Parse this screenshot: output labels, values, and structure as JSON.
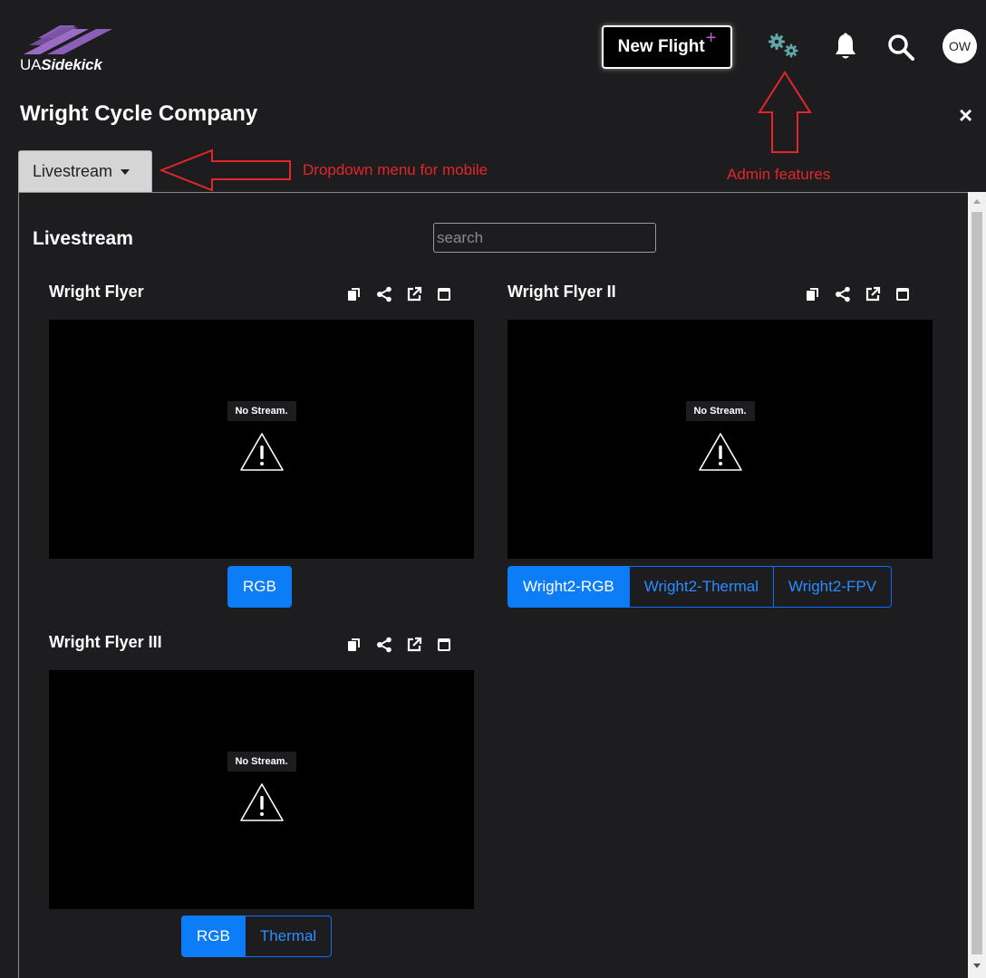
{
  "header": {
    "logo_text_a": "UA",
    "logo_text_b": "Sidekick",
    "new_flight_label": "New Flight",
    "new_flight_plus": "+",
    "avatar_initials": "OW",
    "icons": [
      "gears-icon",
      "bell-icon",
      "search-icon"
    ]
  },
  "company": {
    "name": "Wright Cycle Company",
    "close_label": "×"
  },
  "annotations": {
    "mobile": "Dropdown menu for mobile",
    "admin": "Admin features"
  },
  "tab": {
    "selected": "Livestream"
  },
  "section": {
    "title": "Livestream",
    "search_placeholder": "search"
  },
  "no_stream_text": "No Stream.",
  "cards": [
    {
      "title": "Wright Flyer",
      "buttons": [
        {
          "label": "RGB",
          "active": true
        }
      ]
    },
    {
      "title": "Wright Flyer II",
      "buttons": [
        {
          "label": "Wright2-RGB",
          "active": true
        },
        {
          "label": "Wright2-Thermal",
          "active": false
        },
        {
          "label": "Wright2-FPV",
          "active": false
        }
      ]
    },
    {
      "title": "Wright Flyer III",
      "buttons": [
        {
          "label": "RGB",
          "active": true
        },
        {
          "label": "Thermal",
          "active": false
        }
      ]
    }
  ],
  "colors": {
    "background": "#1d1d1f",
    "accent_blue": "#0d7df7",
    "gear_teal": "#5fa7a8",
    "annotation_red": "#e4262b",
    "logo_purple": "#8a5fb5"
  }
}
